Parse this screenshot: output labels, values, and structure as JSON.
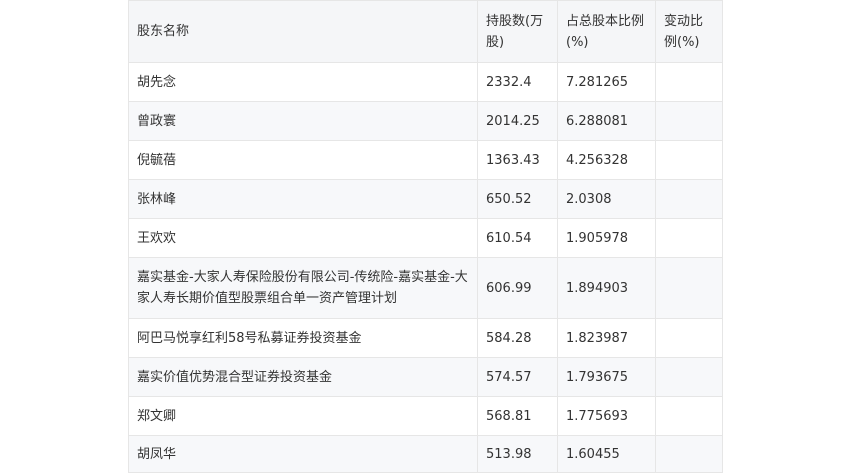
{
  "table": {
    "headers": [
      "股东名称",
      "持股数(万股)",
      "占总股本比例(%)",
      "变动比例(%)"
    ],
    "rows": [
      {
        "name": "胡先念",
        "shares": "2332.4",
        "ratio": "7.281265",
        "change": ""
      },
      {
        "name": "曾政寰",
        "shares": "2014.25",
        "ratio": "6.288081",
        "change": ""
      },
      {
        "name": "倪毓蓓",
        "shares": "1363.43",
        "ratio": "4.256328",
        "change": ""
      },
      {
        "name": "张林峰",
        "shares": "650.52",
        "ratio": "2.0308",
        "change": ""
      },
      {
        "name": "王欢欢",
        "shares": "610.54",
        "ratio": "1.905978",
        "change": ""
      },
      {
        "name": "嘉实基金-大家人寿保险股份有限公司-传统险-嘉实基金-大家人寿长期价值型股票组合单一资产管理计划",
        "shares": "606.99",
        "ratio": "1.894903",
        "change": ""
      },
      {
        "name": "阿巴马悦享红利58号私募证券投资基金",
        "shares": "584.28",
        "ratio": "1.823987",
        "change": ""
      },
      {
        "name": "嘉实价值优势混合型证券投资基金",
        "shares": "574.57",
        "ratio": "1.793675",
        "change": ""
      },
      {
        "name": "郑文卿",
        "shares": "568.81",
        "ratio": "1.775693",
        "change": ""
      },
      {
        "name": "胡凤华",
        "shares": "513.98",
        "ratio": "1.60455",
        "change": ""
      }
    ]
  }
}
